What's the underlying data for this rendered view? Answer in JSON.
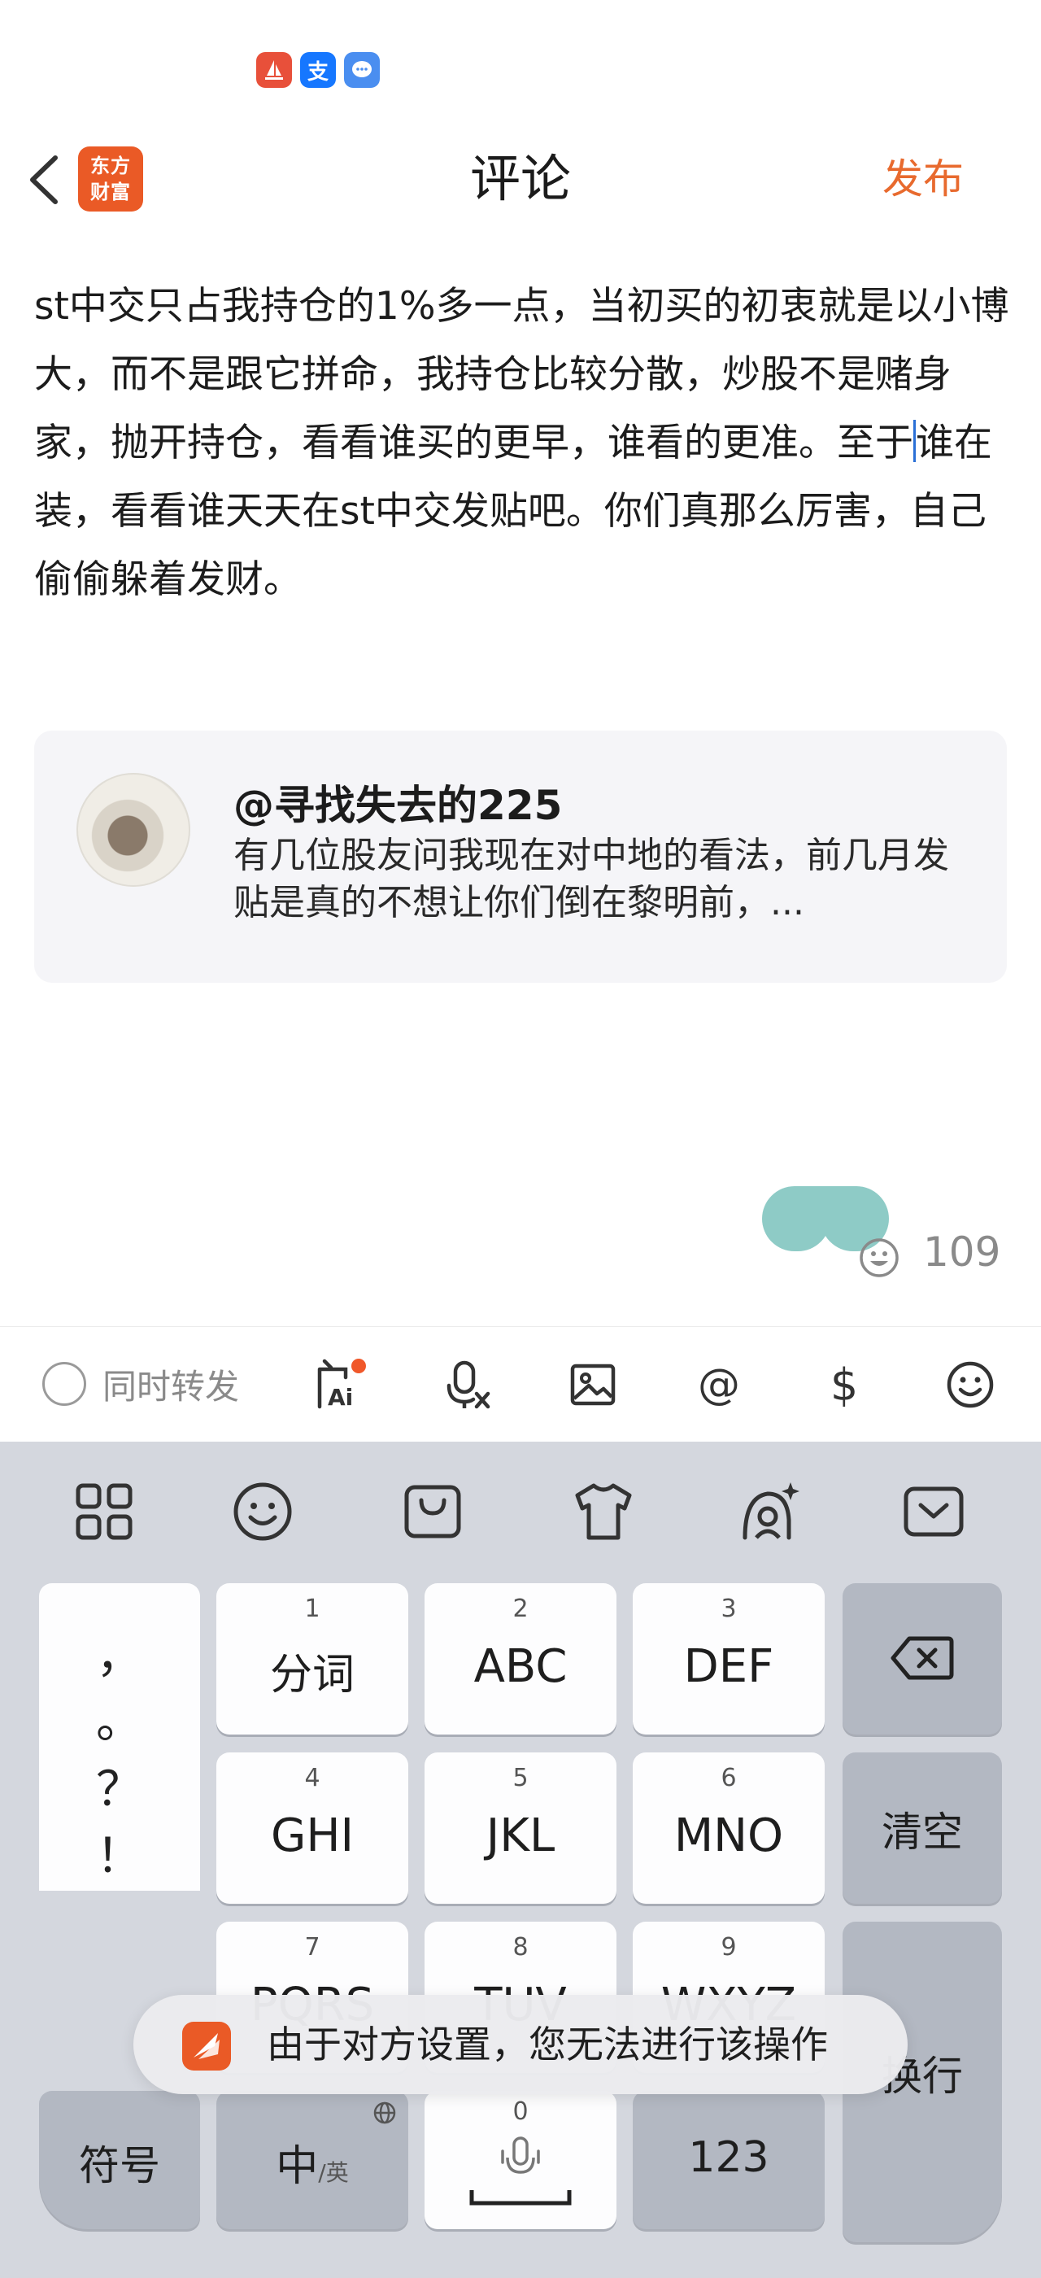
{
  "status_bar": {
    "icons": [
      "sail-icon",
      "alipay-icon",
      "message-icon"
    ],
    "alipay_glyph": "支"
  },
  "header": {
    "logo_line1": "东方",
    "logo_line2": "财富",
    "title": "评论",
    "publish_label": "发布"
  },
  "comment": {
    "text_before_caret": "st中交只占我持仓的1%多一点，当初买的初衷就是以小博大，而不是跟它拼命，我持仓比较分散，炒股不是赌身家，抛开持仓，看看谁买的更早，谁看的更准。至于",
    "text_after_caret": "谁在装，看看谁天天在st中交发贴吧。你们真那么厉害，自己偷偷躲着发财。"
  },
  "quote": {
    "user": "@寻找失去的225",
    "body": "有几位股友问我现在对中地的看法，前几月发贴是真的不想让你们倒在黎明前，..."
  },
  "counter": {
    "value": "109"
  },
  "toolbar": {
    "forward_label": "同时转发",
    "icons": [
      "ai-question-icon",
      "voice-to-text-icon",
      "image-icon",
      "at-icon",
      "dollar-icon",
      "emoji-icon"
    ],
    "ai_badge_color": "#f0582a",
    "at_glyph": "@",
    "dollar_glyph": "$"
  },
  "keyboard": {
    "top_icons": [
      "grid-icon",
      "emoji-icon",
      "bag-icon",
      "tshirt-icon",
      "ai-avatar-icon",
      "collapse-keyboard-icon"
    ],
    "punctuation": [
      "，",
      "。",
      "？",
      "！"
    ],
    "keys": [
      {
        "num": "1",
        "label": "分词"
      },
      {
        "num": "2",
        "label": "ABC"
      },
      {
        "num": "3",
        "label": "DEF"
      },
      {
        "num": "4",
        "label": "GHI"
      },
      {
        "num": "5",
        "label": "JKL"
      },
      {
        "num": "6",
        "label": "MNO"
      },
      {
        "num": "7",
        "label": "PQRS"
      },
      {
        "num": "8",
        "label": "TUV"
      },
      {
        "num": "9",
        "label": "WXYZ"
      }
    ],
    "clear_label": "清空",
    "enter_label": "换行",
    "symbol_label": "符号",
    "lang_main": "中",
    "lang_sub": "/英",
    "space_num": "0",
    "num_label": "123"
  },
  "toast": {
    "text": "由于对方设置，您无法进行该操作"
  }
}
